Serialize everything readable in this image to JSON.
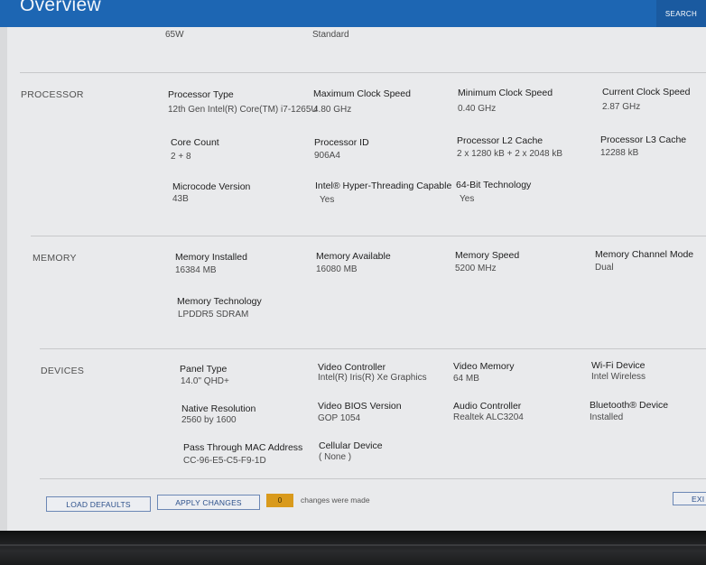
{
  "header": {
    "title": "Overview",
    "search_label": "SEARCH"
  },
  "top_values": {
    "wattage": "65W",
    "standard": "Standard"
  },
  "processor": {
    "section_label": "PROCESSOR",
    "processor_type_label": "Processor Type",
    "processor_type_value": "12th Gen Intel(R) Core(TM) i7-1265U",
    "max_clock_label": "Maximum Clock Speed",
    "max_clock_value": "4.80 GHz",
    "min_clock_label": "Minimum Clock Speed",
    "min_clock_value": "0.40 GHz",
    "current_clock_label": "Current Clock Speed",
    "current_clock_value": "2.87 GHz",
    "core_count_label": "Core Count",
    "core_count_value": "2 + 8",
    "processor_id_label": "Processor ID",
    "processor_id_value": "906A4",
    "l2_cache_label": "Processor L2 Cache",
    "l2_cache_value": "2 x 1280  kB + 2 x 2048  kB",
    "l3_cache_label": "Processor L3 Cache",
    "l3_cache_value": "12288 kB",
    "microcode_label": "Microcode Version",
    "microcode_value": "43B",
    "hyperthreading_label": "Intel® Hyper-Threading Capable",
    "hyperthreading_value": "Yes",
    "bit64_label": "64-Bit Technology",
    "bit64_value": "Yes"
  },
  "memory": {
    "section_label": "MEMORY",
    "installed_label": "Memory Installed",
    "installed_value": "16384 MB",
    "available_label": "Memory Available",
    "available_value": "16080 MB",
    "speed_label": "Memory Speed",
    "speed_value": "5200 MHz",
    "channel_label": "Memory Channel Mode",
    "channel_value": "Dual",
    "technology_label": "Memory Technology",
    "technology_value": "LPDDR5 SDRAM"
  },
  "devices": {
    "section_label": "DEVICES",
    "panel_type_label": "Panel Type",
    "panel_type_value": "14.0\" QHD+",
    "video_controller_label": "Video Controller",
    "video_controller_value": "Intel(R) Iris(R) Xe Graphics",
    "video_memory_label": "Video Memory",
    "video_memory_value": "64 MB",
    "wifi_label": "Wi-Fi Device",
    "wifi_value": "Intel Wireless",
    "native_res_label": "Native Resolution",
    "native_res_value": "2560 by 1600",
    "video_bios_label": "Video BIOS Version",
    "video_bios_value": "GOP 1054",
    "audio_label": "Audio Controller",
    "audio_value": "Realtek ALC3204",
    "bluetooth_label": "Bluetooth® Device",
    "bluetooth_value": "Installed",
    "mac_label": "Pass Through MAC Address",
    "mac_value": "CC-96-E5-C5-F9-1D",
    "cellular_label": "Cellular Device",
    "cellular_value": "( None )"
  },
  "footer": {
    "load_defaults_label": "LOAD DEFAULTS",
    "apply_changes_label": "APPLY CHANGES",
    "changes_count": "0",
    "changes_text": "changes were made",
    "exit_label": "EXI"
  },
  "colors": {
    "header_blue": "#1d66b3",
    "counter_orange": "#d99a1c",
    "page_bg": "#e9eaec"
  }
}
